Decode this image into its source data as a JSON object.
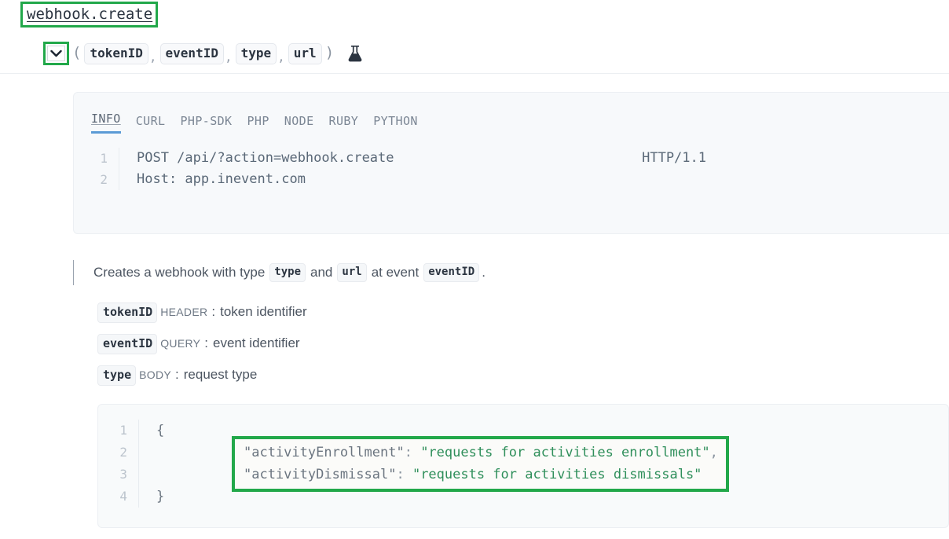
{
  "endpoint": {
    "title": "webhook.create",
    "expand_icon": "chevron-down-icon",
    "test_icon": "flask-icon",
    "open_paren": "(",
    "close_paren": ")",
    "separator": ",",
    "params": [
      "tokenID",
      "eventID",
      "type",
      "url"
    ]
  },
  "code_panel": {
    "tabs": [
      {
        "label": "INFO",
        "active": true
      },
      {
        "label": "CURL",
        "active": false
      },
      {
        "label": "PHP-SDK",
        "active": false
      },
      {
        "label": "PHP",
        "active": false
      },
      {
        "label": "NODE",
        "active": false
      },
      {
        "label": "RUBY",
        "active": false
      },
      {
        "label": "PYTHON",
        "active": false
      }
    ],
    "line_numbers": [
      "1",
      "2"
    ],
    "lines": [
      {
        "left": "POST /api/?action=webhook.create",
        "right": "HTTP/1.1"
      },
      {
        "left": "Host: app.inevent.com",
        "right": ""
      }
    ]
  },
  "description": {
    "part1": "Creates a webhook with type",
    "code1": "type",
    "part2": "and",
    "code2": "url",
    "part3": "at event",
    "code3": "eventID",
    "part4": "."
  },
  "parameters": [
    {
      "name": "tokenID",
      "location": "HEADER",
      "colon": ":",
      "description": "token identifier"
    },
    {
      "name": "eventID",
      "location": "QUERY",
      "colon": ":",
      "description": "event identifier"
    },
    {
      "name": "type",
      "location": "BODY",
      "colon": ":",
      "description": "request type"
    }
  ],
  "json_panel": {
    "line_numbers": [
      "1",
      "2",
      "3",
      "4"
    ],
    "open_brace": "{",
    "close_brace": "}",
    "entries": [
      {
        "key": "\"activityEnrollment\"",
        "colon": ": ",
        "value": "\"requests for activities enrollment\"",
        "trailing": ","
      },
      {
        "key": "\"activityDismissal\"",
        "colon": ": ",
        "value": "\"requests for activities dismissals\"",
        "trailing": ""
      }
    ]
  },
  "colors": {
    "highlight_green": "#22a84a",
    "tab_active_underline": "#5b9bd5",
    "json_string": "#2f8f5b",
    "code_text": "#5a6877",
    "panel_bg": "#f7f9fb"
  }
}
